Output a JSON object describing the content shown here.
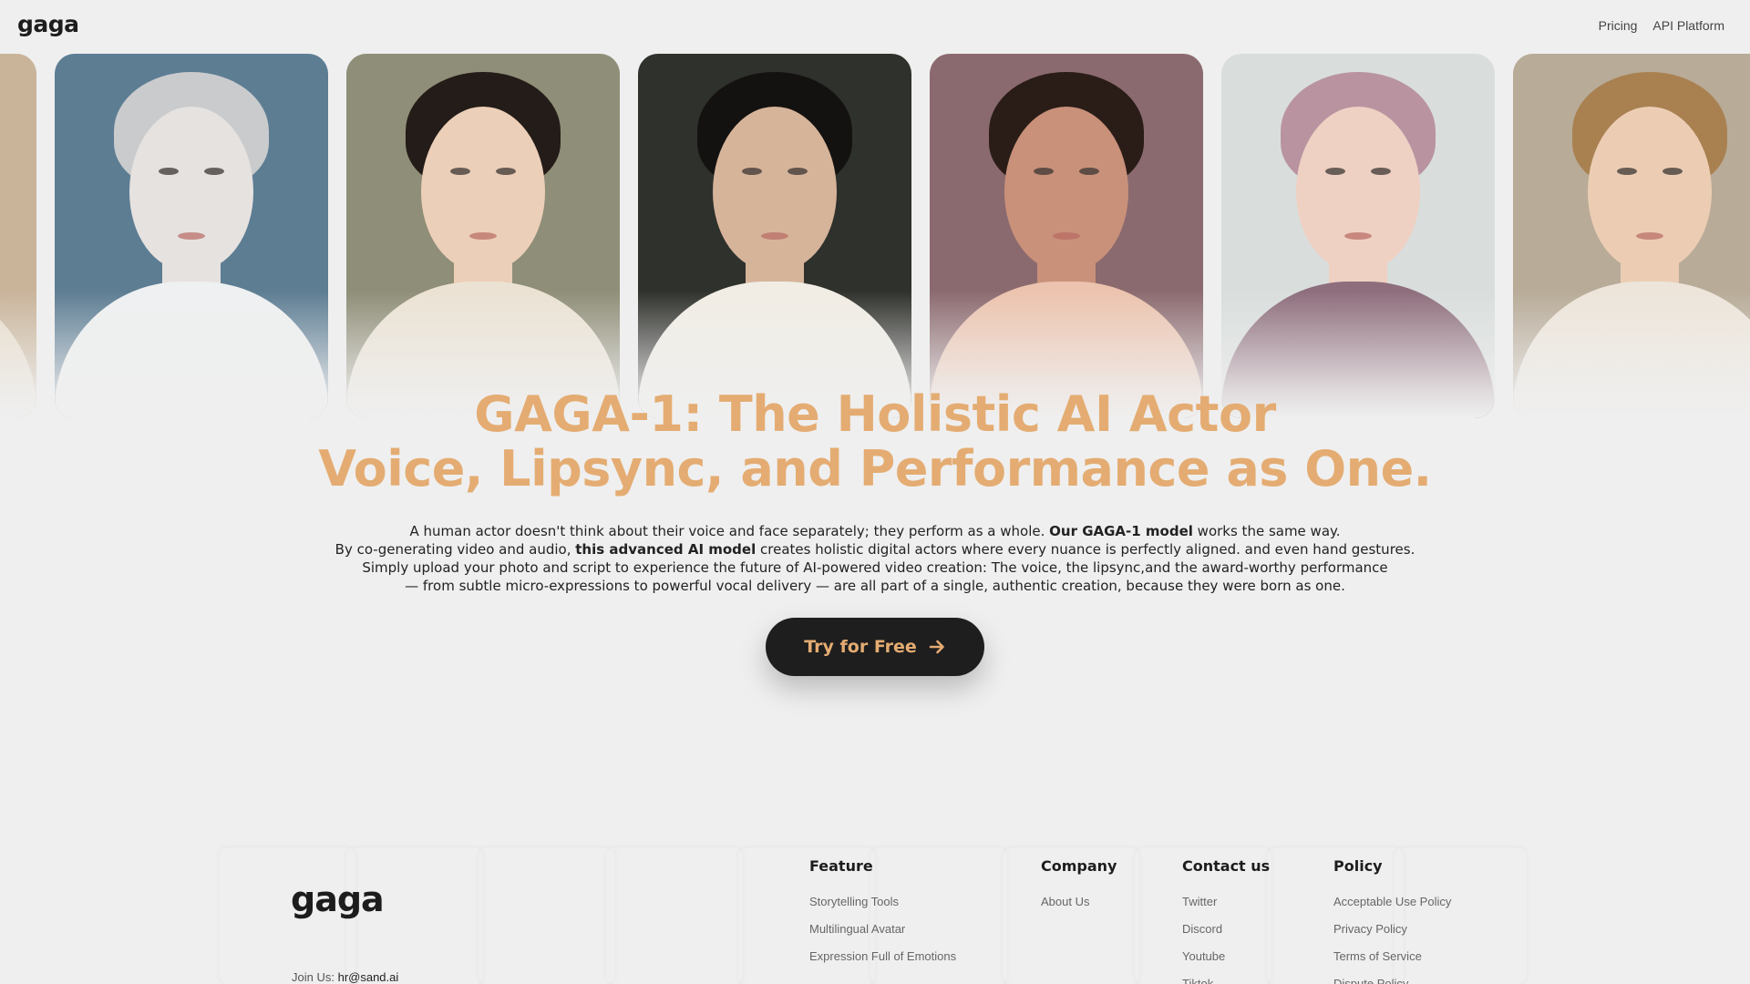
{
  "header": {
    "logo_text": "gaga",
    "nav": [
      {
        "label": "Pricing"
      },
      {
        "label": "API Platform"
      }
    ]
  },
  "portraits": [
    {
      "name": "portrait-partial-left",
      "bg": "#c9b49a",
      "skin": "#e0c9ad",
      "hair": "#b89a78",
      "body": "#e8dcc9"
    },
    {
      "name": "portrait-silver-hair",
      "bg": "#5d7d93",
      "skin": "#e6e2df",
      "hair": "#c9cbcd",
      "body": "#eef0f1"
    },
    {
      "name": "portrait-dark-updo",
      "bg": "#8f8e78",
      "skin": "#eccfb8",
      "hair": "#231c18",
      "body": "#ebe2d3"
    },
    {
      "name": "portrait-wavy-hair-man",
      "bg": "#2f312c",
      "skin": "#d6b49a",
      "hair": "#141210",
      "body": "#f1ede4"
    },
    {
      "name": "portrait-curly-hair",
      "bg": "#8b6a6f",
      "skin": "#c9917a",
      "hair": "#2a1d18",
      "body": "#ecc3ae"
    },
    {
      "name": "portrait-hood-pink-hair",
      "bg": "#d9dedd",
      "skin": "#efd1c4",
      "hair": "#b994a0",
      "body": "#8e6e7c"
    },
    {
      "name": "portrait-smiling-blonde",
      "bg": "#b8ab98",
      "skin": "#eccdb4",
      "hair": "#a98151",
      "body": "#ede5da"
    }
  ],
  "hero": {
    "title_line1": "GAGA-1: The Holistic AI Actor",
    "title_line2": "Voice, Lipsync, and Performance as One.",
    "p1_a": "A human actor doesn't think about their voice and face separately; they perform as a whole. ",
    "p1_b": "Our GAGA-1 model",
    "p1_c": " works the same way.",
    "p2_a": "By co-generating video and audio, ",
    "p2_b": "this advanced AI model",
    "p2_c": " creates holistic digital actors where every nuance is perfectly aligned. and even hand gestures.",
    "p3": "Simply upload your photo and script to experience the future of AI-powered video creation: The voice, the lipsync,and the award-worthy performance",
    "p4": "— from subtle micro-expressions to powerful vocal delivery — are all part of a single, authentic creation, because they were born as one.",
    "cta_label": "Try for Free",
    "accent_color": "#e4ac72"
  },
  "footer": {
    "logo_text": "gaga",
    "join_label": "Join Us:",
    "join_email": "hr@sand.ai",
    "columns": [
      {
        "title": "Feature",
        "links": [
          "Storytelling Tools",
          "Multilingual Avatar",
          "Expression Full of Emotions"
        ]
      },
      {
        "title": "Company",
        "links": [
          "About Us"
        ]
      },
      {
        "title": "Contact us",
        "links": [
          "Twitter",
          "Discord",
          "Youtube",
          "Tiktok"
        ]
      },
      {
        "title": "Policy",
        "links": [
          "Acceptable Use Policy",
          "Privacy Policy",
          "Terms of Service",
          "Dispute Policy"
        ]
      }
    ]
  }
}
